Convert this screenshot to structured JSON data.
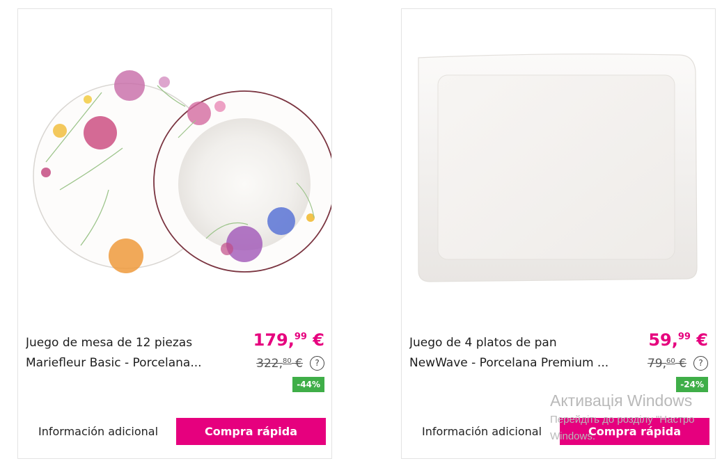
{
  "products": [
    {
      "image_alt": "mariefleur-dinnerware-set",
      "title_line1": "Juego de mesa de 12 piezas",
      "title_line2": "Mariefleur Basic - Porcelana...",
      "price_main": "179,",
      "price_cents": "99",
      "price_currency": " €",
      "old_price_main": "322,",
      "old_price_cents": "80",
      "old_price_currency": " €",
      "help_symbol": "?",
      "discount": "-44%",
      "info_label": "Información adicional",
      "buy_label": "Compra rápida"
    },
    {
      "image_alt": "newwave-bread-plates",
      "title_line1": "Juego de 4 platos de pan",
      "title_line2": "NewWave - Porcelana Premium ...",
      "price_main": "59,",
      "price_cents": "99",
      "price_currency": " €",
      "old_price_main": "79,",
      "old_price_cents": "60",
      "old_price_currency": " €",
      "help_symbol": "?",
      "discount": "-24%",
      "info_label": "Información adicional",
      "buy_label": "Compra rápida"
    }
  ],
  "watermark": {
    "title": "Активація Windows",
    "subtitle_line1": "Перейдіть до розділу \"Настро",
    "subtitle_line2": "Windows."
  },
  "colors": {
    "accent": "#e6007e",
    "discount_badge": "#3fae48"
  }
}
